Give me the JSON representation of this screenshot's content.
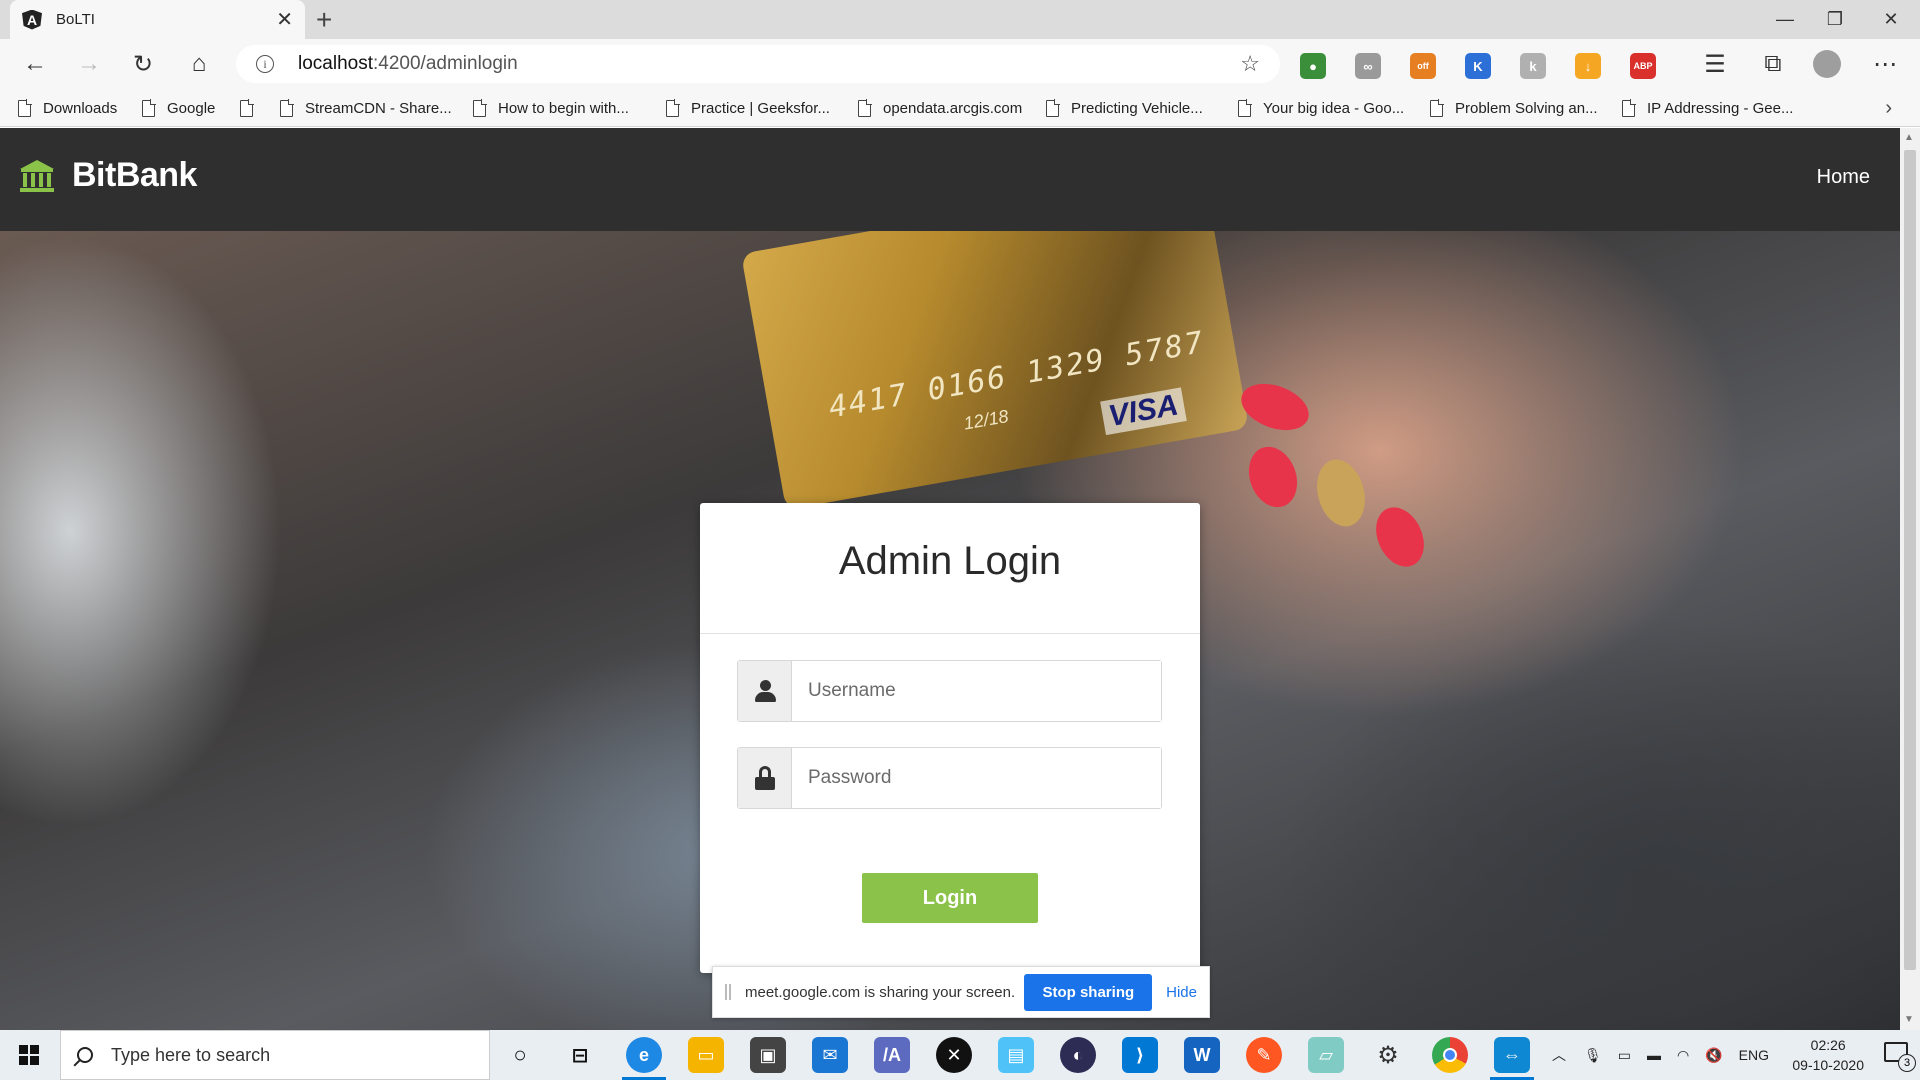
{
  "browser": {
    "tab_title": "BoLTI",
    "tab_favicon": "A",
    "url_host": "localhost",
    "url_path": ":4200/adminlogin",
    "bookmarks": [
      "Downloads",
      "Google",
      "",
      "StreamCDN - Share...",
      "How to begin with...",
      "Practice | Geeksfor...",
      "opendata.arcgis.com",
      "Predicting Vehicle...",
      "Your big idea - Goo...",
      "Problem Solving an...",
      "IP Addressing - Gee..."
    ],
    "extensions": [
      {
        "name": "globe-extension-icon",
        "color": "#3b8f3b",
        "glyph": "●"
      },
      {
        "name": "tracker-extension-icon",
        "color": "#9a9a9a",
        "glyph": "∞"
      },
      {
        "name": "honey-off-extension-icon",
        "color": "#e67e22",
        "glyph": "off"
      },
      {
        "name": "shield-extension-icon",
        "color": "#2c6fd6",
        "glyph": "K"
      },
      {
        "name": "key-extension-icon",
        "color": "#b0b0b0",
        "glyph": "k"
      },
      {
        "name": "download-extension-icon",
        "color": "#f5a623",
        "glyph": "↓"
      },
      {
        "name": "adblock-extension-icon",
        "color": "#d9302c",
        "glyph": "ABP"
      }
    ]
  },
  "navbar": {
    "brand": "BitBank",
    "home_link": "Home",
    "accent_color": "#8bc34a"
  },
  "hero": {
    "card_number": "4417 0166 1329 5787",
    "card_expiry": "12/18",
    "card_brand": "VISA"
  },
  "login": {
    "title": "Admin Login",
    "username_placeholder": "Username",
    "password_placeholder": "Password",
    "button_label": "Login"
  },
  "screen_share": {
    "message": "meet.google.com is sharing your screen.",
    "stop_label": "Stop sharing",
    "hide_label": "Hide"
  },
  "taskbar": {
    "search_placeholder": "Type here to search",
    "language": "ENG",
    "time": "02:26",
    "date": "09-10-2020",
    "notification_count": "3"
  }
}
